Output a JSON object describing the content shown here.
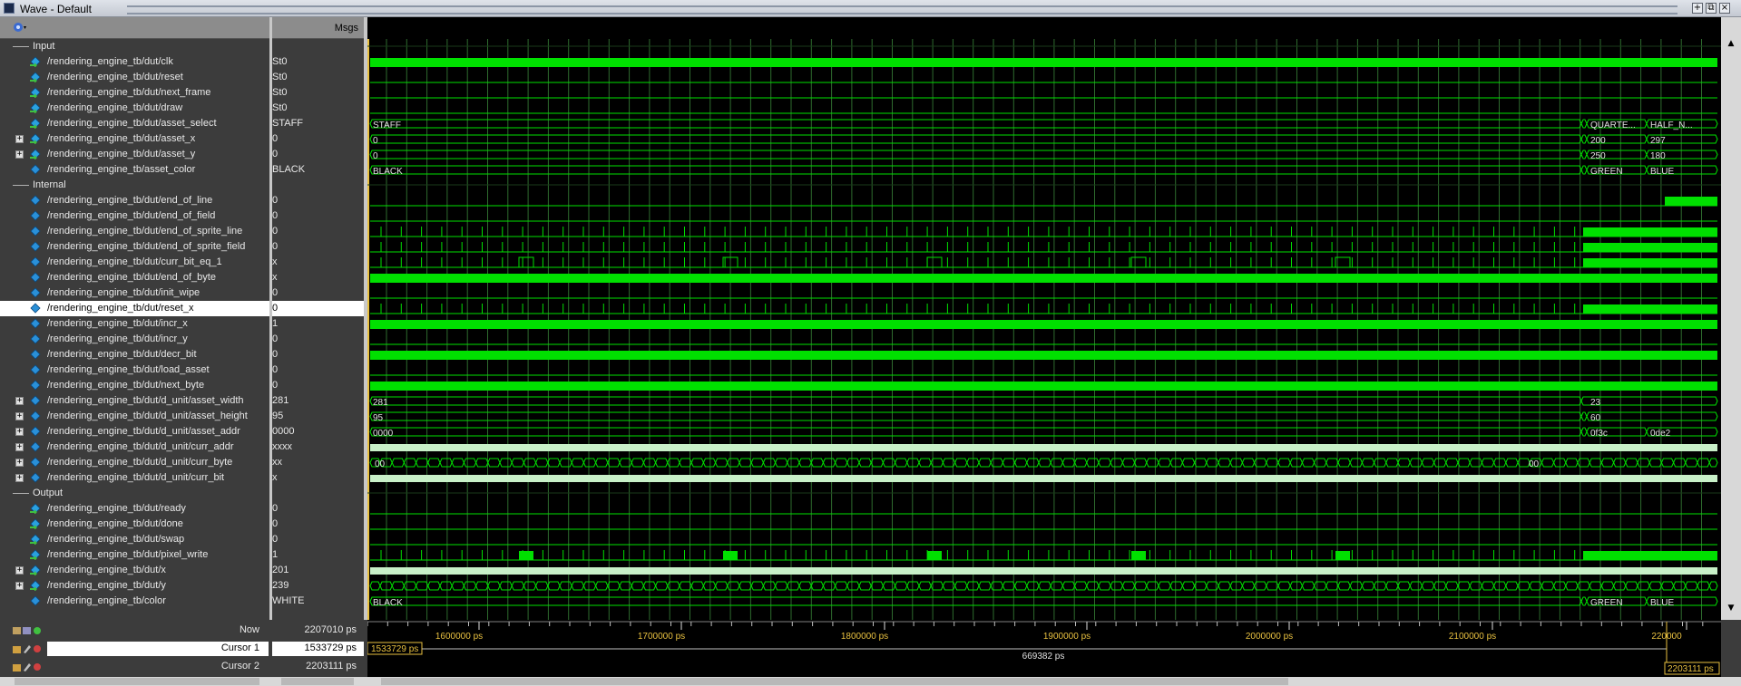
{
  "window": {
    "title": "Wave - Default",
    "buttons": [
      "+",
      "⧉",
      "×"
    ]
  },
  "header": {
    "msgs_label": "Msgs"
  },
  "groups": [
    {
      "label": "Input",
      "row": 0
    },
    {
      "label": "Internal",
      "row": 9
    },
    {
      "label": "Output",
      "row": 29
    }
  ],
  "signals": [
    {
      "row": 1,
      "name": "/rendering_engine_tb/dut/clk",
      "value": "St0",
      "expand": false,
      "icon": "input-signal-icon"
    },
    {
      "row": 2,
      "name": "/rendering_engine_tb/dut/reset",
      "value": "St0",
      "expand": false,
      "icon": "input-signal-icon"
    },
    {
      "row": 3,
      "name": "/rendering_engine_tb/dut/next_frame",
      "value": "St0",
      "expand": false,
      "icon": "input-signal-icon"
    },
    {
      "row": 4,
      "name": "/rendering_engine_tb/dut/draw",
      "value": "St0",
      "expand": false,
      "icon": "input-signal-icon"
    },
    {
      "row": 5,
      "name": "/rendering_engine_tb/dut/asset_select",
      "value": "STAFF",
      "expand": false,
      "icon": "input-signal-icon"
    },
    {
      "row": 6,
      "name": "/rendering_engine_tb/dut/asset_x",
      "value": "0",
      "expand": true,
      "icon": "input-signal-icon"
    },
    {
      "row": 7,
      "name": "/rendering_engine_tb/dut/asset_y",
      "value": "0",
      "expand": true,
      "icon": "input-signal-icon"
    },
    {
      "row": 8,
      "name": "/rendering_engine_tb/asset_color",
      "value": "BLACK",
      "expand": false,
      "icon": "internal-signal-icon"
    },
    {
      "row": 10,
      "name": "/rendering_engine_tb/dut/end_of_line",
      "value": "0",
      "expand": false,
      "icon": "internal-signal-icon"
    },
    {
      "row": 11,
      "name": "/rendering_engine_tb/dut/end_of_field",
      "value": "0",
      "expand": false,
      "icon": "internal-signal-icon"
    },
    {
      "row": 12,
      "name": "/rendering_engine_tb/dut/end_of_sprite_line",
      "value": "0",
      "expand": false,
      "icon": "internal-signal-icon"
    },
    {
      "row": 13,
      "name": "/rendering_engine_tb/dut/end_of_sprite_field",
      "value": "0",
      "expand": false,
      "icon": "internal-signal-icon"
    },
    {
      "row": 14,
      "name": "/rendering_engine_tb/dut/curr_bit_eq_1",
      "value": "x",
      "expand": false,
      "icon": "internal-signal-icon"
    },
    {
      "row": 15,
      "name": "/rendering_engine_tb/dut/end_of_byte",
      "value": "x",
      "expand": false,
      "icon": "internal-signal-icon"
    },
    {
      "row": 16,
      "name": "/rendering_engine_tb/dut/init_wipe",
      "value": "0",
      "expand": false,
      "icon": "internal-signal-icon"
    },
    {
      "row": 17,
      "name": "/rendering_engine_tb/dut/reset_x",
      "value": "0",
      "expand": false,
      "icon": "internal-signal-icon",
      "selected": true
    },
    {
      "row": 18,
      "name": "/rendering_engine_tb/dut/incr_x",
      "value": "1",
      "expand": false,
      "icon": "internal-signal-icon"
    },
    {
      "row": 19,
      "name": "/rendering_engine_tb/dut/incr_y",
      "value": "0",
      "expand": false,
      "icon": "internal-signal-icon"
    },
    {
      "row": 20,
      "name": "/rendering_engine_tb/dut/decr_bit",
      "value": "0",
      "expand": false,
      "icon": "internal-signal-icon"
    },
    {
      "row": 21,
      "name": "/rendering_engine_tb/dut/load_asset",
      "value": "0",
      "expand": false,
      "icon": "internal-signal-icon"
    },
    {
      "row": 22,
      "name": "/rendering_engine_tb/dut/next_byte",
      "value": "0",
      "expand": false,
      "icon": "internal-signal-icon"
    },
    {
      "row": 23,
      "name": "/rendering_engine_tb/dut/d_unit/asset_width",
      "value": "281",
      "expand": true,
      "icon": "internal-signal-icon"
    },
    {
      "row": 24,
      "name": "/rendering_engine_tb/dut/d_unit/asset_height",
      "value": "95",
      "expand": true,
      "icon": "internal-signal-icon"
    },
    {
      "row": 25,
      "name": "/rendering_engine_tb/dut/d_unit/asset_addr",
      "value": "0000",
      "expand": true,
      "icon": "internal-signal-icon"
    },
    {
      "row": 26,
      "name": "/rendering_engine_tb/dut/d_unit/curr_addr",
      "value": "xxxx",
      "expand": true,
      "icon": "internal-signal-icon"
    },
    {
      "row": 27,
      "name": "/rendering_engine_tb/dut/d_unit/curr_byte",
      "value": "xx",
      "expand": true,
      "icon": "internal-signal-icon"
    },
    {
      "row": 28,
      "name": "/rendering_engine_tb/dut/d_unit/curr_bit",
      "value": "x",
      "expand": true,
      "icon": "internal-signal-icon"
    },
    {
      "row": 30,
      "name": "/rendering_engine_tb/dut/ready",
      "value": "0",
      "expand": false,
      "icon": "output-signal-icon"
    },
    {
      "row": 31,
      "name": "/rendering_engine_tb/dut/done",
      "value": "0",
      "expand": false,
      "icon": "output-signal-icon"
    },
    {
      "row": 32,
      "name": "/rendering_engine_tb/dut/swap",
      "value": "0",
      "expand": false,
      "icon": "output-signal-icon"
    },
    {
      "row": 33,
      "name": "/rendering_engine_tb/dut/pixel_write",
      "value": "1",
      "expand": false,
      "icon": "output-signal-icon"
    },
    {
      "row": 34,
      "name": "/rendering_engine_tb/dut/x",
      "value": "201",
      "expand": true,
      "icon": "output-signal-icon"
    },
    {
      "row": 35,
      "name": "/rendering_engine_tb/dut/y",
      "value": "239",
      "expand": true,
      "icon": "output-signal-icon"
    },
    {
      "row": 36,
      "name": "/rendering_engine_tb/color",
      "value": "WHITE",
      "expand": false,
      "icon": "internal-signal-icon"
    }
  ],
  "bus_labels": [
    {
      "row": 5,
      "texts": [
        "STAFF",
        "QUARTE...",
        "HALF_N..."
      ]
    },
    {
      "row": 6,
      "texts": [
        "0",
        "200",
        "297"
      ]
    },
    {
      "row": 7,
      "texts": [
        "0",
        "250",
        "180"
      ]
    },
    {
      "row": 8,
      "texts": [
        "BLACK",
        "GREEN",
        "BLUE"
      ]
    },
    {
      "row": 23,
      "texts": [
        "281",
        "23"
      ]
    },
    {
      "row": 24,
      "texts": [
        "95",
        "60"
      ]
    },
    {
      "row": 25,
      "texts": [
        "0000",
        "0f3c",
        "0de2"
      ]
    },
    {
      "row": 27,
      "texts": [
        "00",
        "00"
      ]
    },
    {
      "row": 36,
      "texts": [
        "BLACK",
        "GREEN",
        "BLUE"
      ]
    }
  ],
  "status": {
    "now_label": "Now",
    "now_value": "2207010 ps",
    "cursor1_label": "Cursor 1",
    "cursor1_value": "1533729 ps",
    "cursor2_label": "Cursor 2",
    "cursor2_value": "2203111 ps"
  },
  "timeline": {
    "ticks": [
      "1600000 ps",
      "1700000 ps",
      "1800000 ps",
      "1900000 ps",
      "2000000 ps",
      "2100000 ps",
      "220000"
    ],
    "cursor1_tag": "1533729 ps",
    "delta": "669382 ps",
    "cursor2_tag": "2203111 ps"
  },
  "colors": {
    "wave": "#00e000",
    "bus": "#c8f0c8",
    "grid": "#2e6b2e",
    "cursor": "#e8c040"
  }
}
